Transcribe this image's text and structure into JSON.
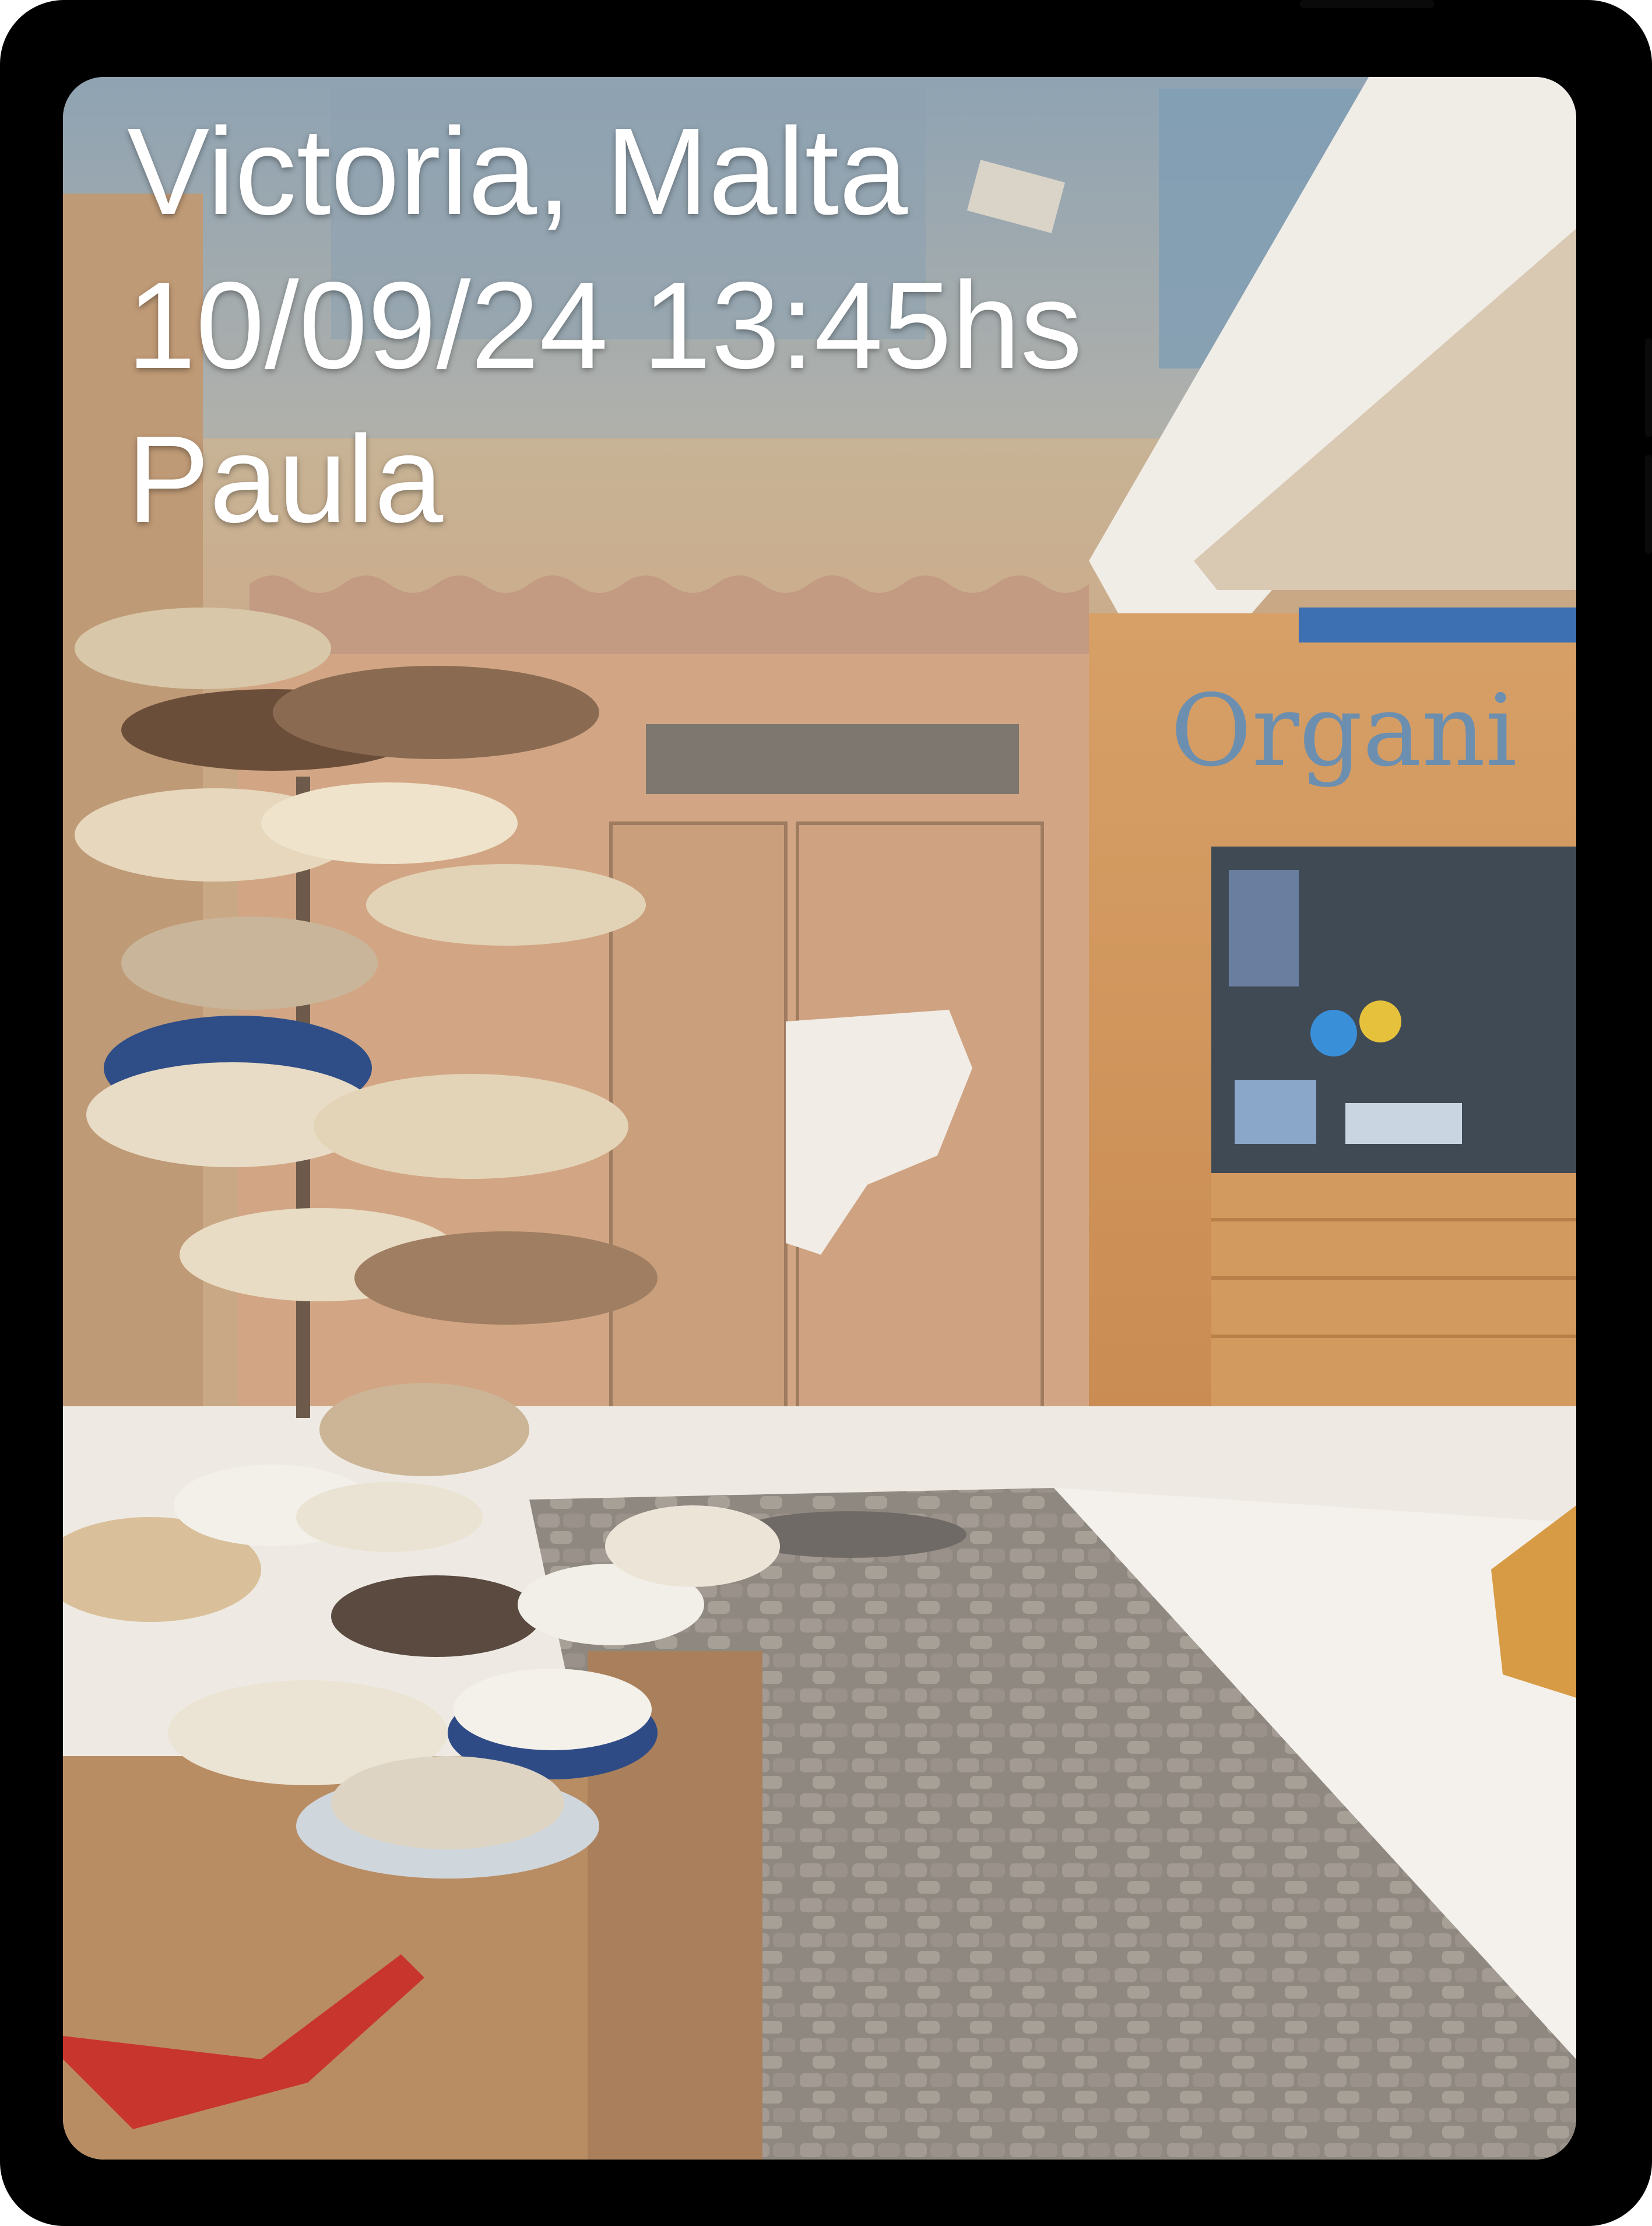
{
  "overlay": {
    "location": "Victoria, Malta",
    "datetime": "10/09/24 13:45hs",
    "author": "Paula"
  },
  "photo": {
    "shop_sign": "Organi",
    "subject": "street-hat-stall-photo"
  },
  "colors": {
    "device_frame": "#000000",
    "overlay_text": "#ffffff"
  }
}
